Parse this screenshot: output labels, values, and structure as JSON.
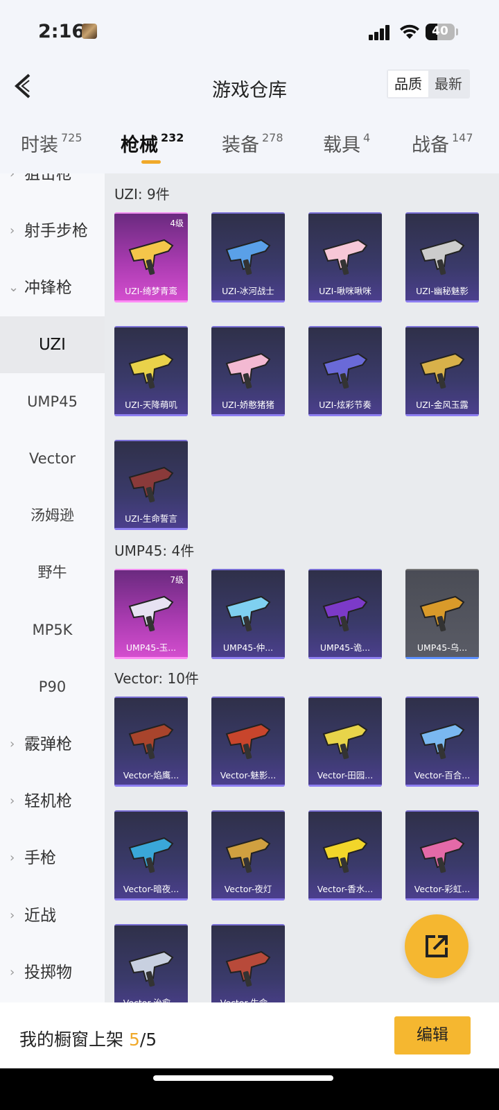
{
  "status": {
    "time": "2:16",
    "battery": "40",
    "battery_level": 0.4
  },
  "header": {
    "title": "游戏仓库",
    "sort_options": [
      "品质",
      "最新"
    ],
    "sort_selected": "品质"
  },
  "tabs": [
    {
      "label": "时装",
      "count": "725"
    },
    {
      "label": "枪械",
      "count": "232"
    },
    {
      "label": "装备",
      "count": "278"
    },
    {
      "label": "载具",
      "count": "4"
    },
    {
      "label": "战备",
      "count": "147"
    }
  ],
  "sidebar": {
    "partial_top": "狙击枪",
    "categories": [
      {
        "label": "射手步枪"
      },
      {
        "label": "冲锋枪"
      }
    ],
    "subitems": [
      "UZI",
      "UMP45",
      "Vector",
      "汤姆逊",
      "野牛",
      "MP5K",
      "P90"
    ],
    "more_categories": [
      "霰弹枪",
      "轻机枪",
      "手枪",
      "近战",
      "投掷物"
    ]
  },
  "sections": [
    {
      "title": "UZI: 9件",
      "items": [
        {
          "name": "UZI-绮梦青鸾",
          "level": "4级",
          "style": "pink"
        },
        {
          "name": "UZI-冰河战士",
          "style": "purple"
        },
        {
          "name": "UZI-啾咪啾咪",
          "style": "purple"
        },
        {
          "name": "UZI-幽秘魅影",
          "style": "purple"
        },
        {
          "name": "UZI-天降萌叽",
          "style": "purple"
        },
        {
          "name": "UZI-娇憨猪猪",
          "style": "purple"
        },
        {
          "name": "UZI-炫彩节奏",
          "style": "purple"
        },
        {
          "name": "UZI-金风玉露",
          "style": "purple"
        },
        {
          "name": "UZI-生命誓言",
          "style": "purple"
        }
      ]
    },
    {
      "title": "UMP45: 4件",
      "items": [
        {
          "name": "UMP45-玉...",
          "level": "7级",
          "style": "pink"
        },
        {
          "name": "UMP45-仲...",
          "style": "purple"
        },
        {
          "name": "UMP45-诡...",
          "style": "purple"
        },
        {
          "name": "UMP45-乌...",
          "style": "grey"
        }
      ]
    },
    {
      "title": "Vector: 10件",
      "items": [
        {
          "name": "Vector-焰鹰...",
          "style": "purple"
        },
        {
          "name": "Vector-魅影...",
          "style": "purple"
        },
        {
          "name": "Vector-田园...",
          "style": "purple"
        },
        {
          "name": "Vector-百合...",
          "style": "purple"
        },
        {
          "name": "Vector-暗夜...",
          "style": "purple"
        },
        {
          "name": "Vector-夜灯",
          "style": "purple"
        },
        {
          "name": "Vector-香水...",
          "style": "purple"
        },
        {
          "name": "Vector-彩虹...",
          "style": "purple"
        },
        {
          "name": "Vector-治愈...",
          "style": "purple"
        },
        {
          "name": "Vector-生命...",
          "style": "purple"
        }
      ]
    }
  ],
  "footer": {
    "label": "我的橱窗上架 ",
    "current": "5",
    "total": "/5",
    "edit_label": "编辑"
  },
  "colors": {
    "accent": "#f5b730",
    "tab_underline": "#f0a92a"
  }
}
